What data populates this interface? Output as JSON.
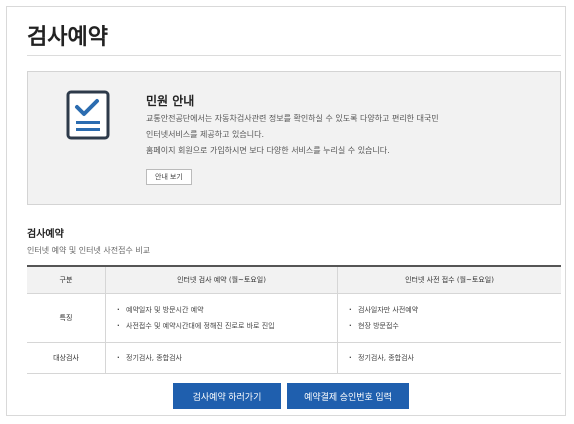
{
  "page": {
    "title": "검사예약"
  },
  "notice": {
    "title": "민원 안내",
    "lines": [
      "교통안전공단에서는 자동차검사관련 정보를 확인하실 수 있도록 다양하고 편리한 대국민",
      "인터넷서비스를 제공하고 있습니다.",
      "홈페이지 회원으로 가입하시면 보다 다양한 서비스를 누리실 수 있습니다."
    ],
    "button_label": "안내 보기",
    "icon": "checklist-icon"
  },
  "section": {
    "title": "검사예약",
    "description": "인터넷 예약 및 인터넷 사전접수 비교"
  },
  "table": {
    "headers": [
      "구분",
      "인터넷 검사 예약 (월~토요일)",
      "인터넷 사전 접수 (월~토요일)"
    ],
    "rows": [
      {
        "category": "특징",
        "col_a": [
          "예약일자 및 방문시간 예약",
          "사전접수 및 예약시간대에 정해진 진로로 바로 진입"
        ],
        "col_b": [
          "검사일자만 사전예약",
          "현장 방문접수"
        ]
      },
      {
        "category": "대상검사",
        "col_a": [
          "정기검사, 종합검사"
        ],
        "col_b": [
          "정기검사, 종합검사"
        ]
      }
    ]
  },
  "actions": {
    "reserve_label": "검사예약 하러가기",
    "payment_label": "예약결제 승인번호 입력"
  },
  "colors": {
    "primary": "#1f5fae",
    "icon_blue": "#2b6cb0",
    "icon_outline": "#2d3a4a"
  }
}
